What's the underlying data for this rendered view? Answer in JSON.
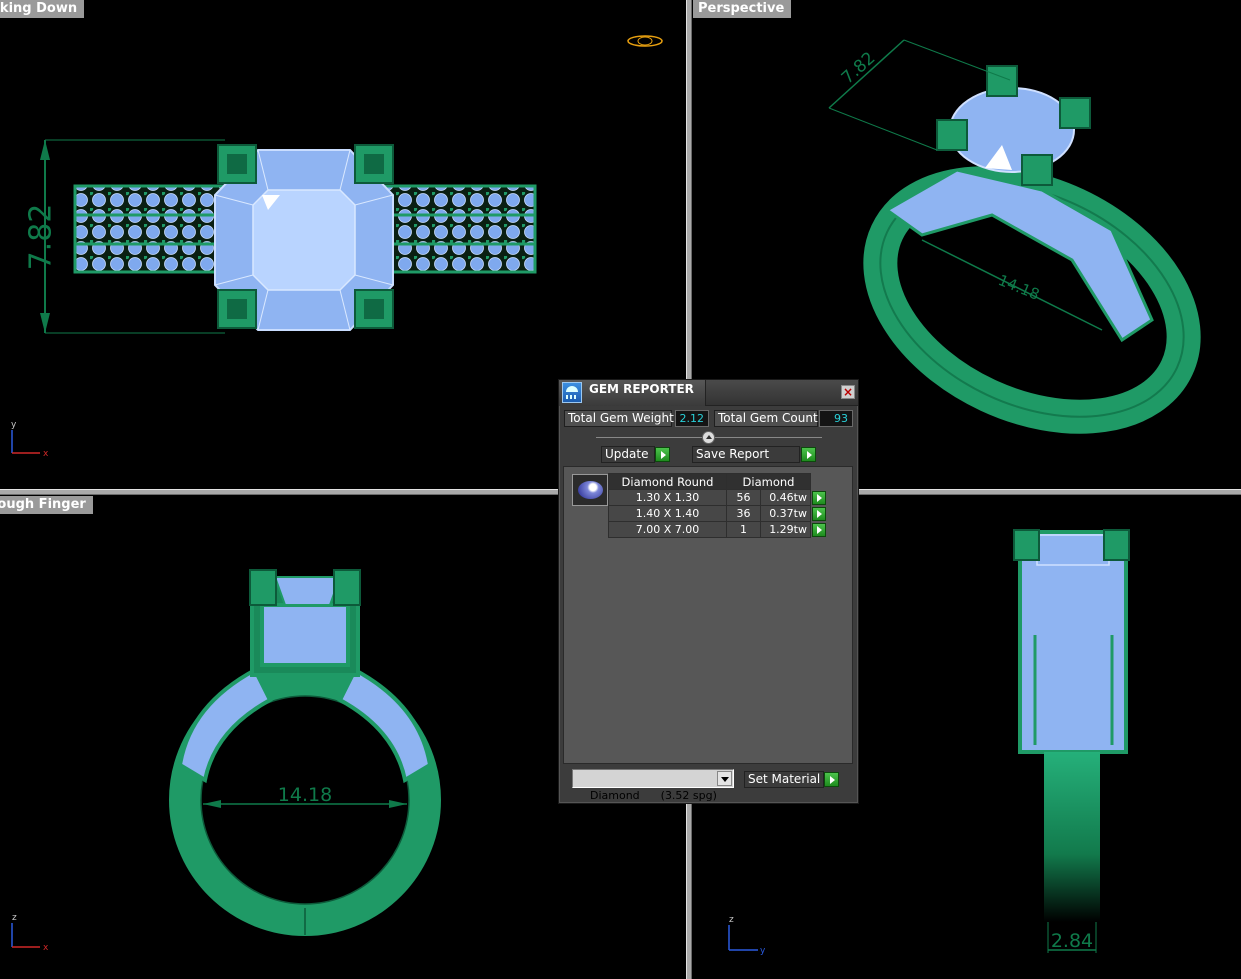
{
  "viewports": {
    "top_left": {
      "label": "oking Down",
      "dimension": "7.82",
      "axis": {
        "a": "y",
        "b": "x"
      }
    },
    "top_right": {
      "label": "Perspective",
      "dim_a": "7.82",
      "dim_b": "14.18"
    },
    "bottom_left": {
      "label": "rough Finger",
      "dimension": "14.18",
      "axis": {
        "a": "z",
        "b": "x"
      }
    },
    "bottom_right": {
      "dimension": "2.84",
      "axis": {
        "a": "z",
        "b": "y"
      }
    }
  },
  "colors": {
    "metal": "#1f9a66",
    "gem": "#9ec3ff",
    "dimension": "#0f7a4a",
    "axis_x": "#d02828",
    "axis_y": "#2a5adf",
    "axis_z": "#2a5adf"
  },
  "gem_reporter": {
    "title": "GEM REPORTER",
    "total_weight_label": "Total Gem Weight",
    "total_weight_value": "2.12",
    "total_count_label": "Total Gem Count",
    "total_count_value": "93",
    "update_label": "Update",
    "save_report_label": "Save Report",
    "table": {
      "gem_icon": "oval-gem-icon",
      "col_shape": "Diamond Round",
      "col_material": "Diamond",
      "rows": [
        {
          "size": "1.30 X 1.30",
          "count": "56",
          "weight": "0.46tw"
        },
        {
          "size": "1.40 X 1.40",
          "count": "36",
          "weight": "0.37tw"
        },
        {
          "size": "7.00 X 7.00",
          "count": "1",
          "weight": "1.29tw"
        }
      ]
    },
    "material_select": "Diamond      (3.52 spg)",
    "set_material_label": "Set Material"
  }
}
